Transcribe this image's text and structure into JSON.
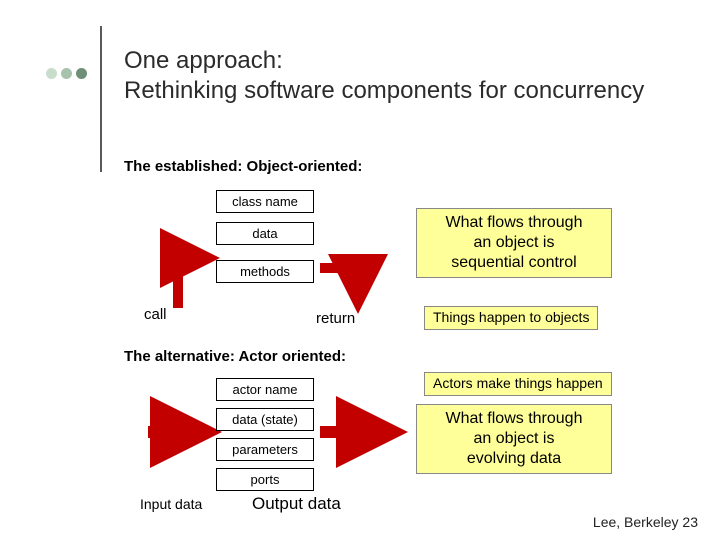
{
  "title": {
    "line1": "One approach:",
    "line2": "Rethinking software components for concurrency"
  },
  "sections": {
    "established": "The established: Object-oriented:",
    "alternative": "The alternative: Actor oriented:"
  },
  "object_box": {
    "class_name": "class name",
    "data": "data",
    "methods": "methods"
  },
  "object_labels": {
    "call": "call",
    "return": "return"
  },
  "object_note": {
    "l1": "What flows through",
    "l2": "an object is",
    "l3": "sequential control"
  },
  "object_small_note": "Things happen to objects",
  "actor_box": {
    "actor_name": "actor name",
    "data_state": "data (state)",
    "parameters": "parameters",
    "ports": "ports"
  },
  "actor_labels": {
    "input": "Input data",
    "output": "Output data"
  },
  "actor_small_note": "Actors make things happen",
  "actor_note": {
    "l1": "What flows through",
    "l2": "an object is",
    "l3": "evolving data"
  },
  "footer": "Lee, Berkeley 23"
}
